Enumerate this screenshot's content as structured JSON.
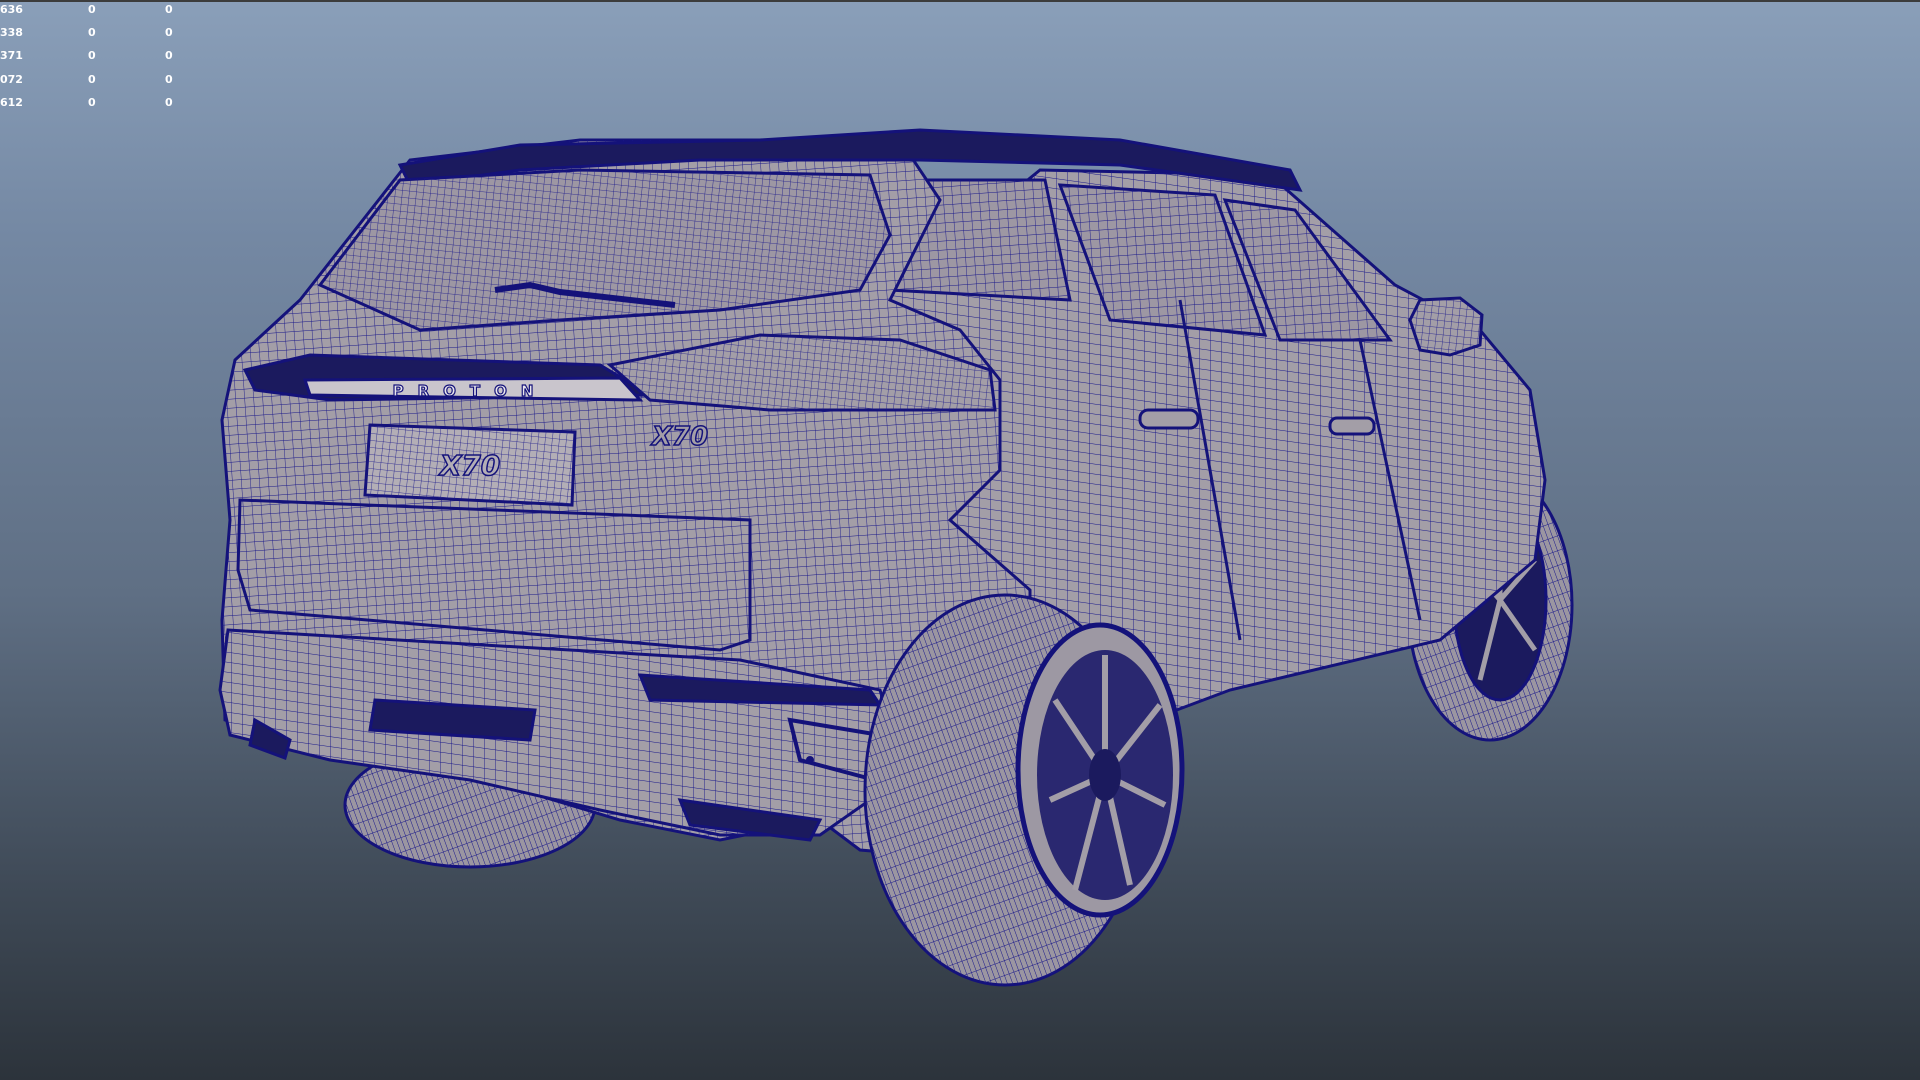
{
  "hud": {
    "rows": [
      [
        "636",
        "0",
        "0"
      ],
      [
        "338",
        "0",
        "0"
      ],
      [
        "371",
        "0",
        "0"
      ],
      [
        "072",
        "0",
        "0"
      ],
      [
        "612",
        "0",
        "0"
      ]
    ]
  },
  "model": {
    "badge_text": "PROTON",
    "plate_text": "X70",
    "emblem_text": "X70",
    "wireframe_color": "#15147a",
    "surface_color": "#a39ea7"
  }
}
